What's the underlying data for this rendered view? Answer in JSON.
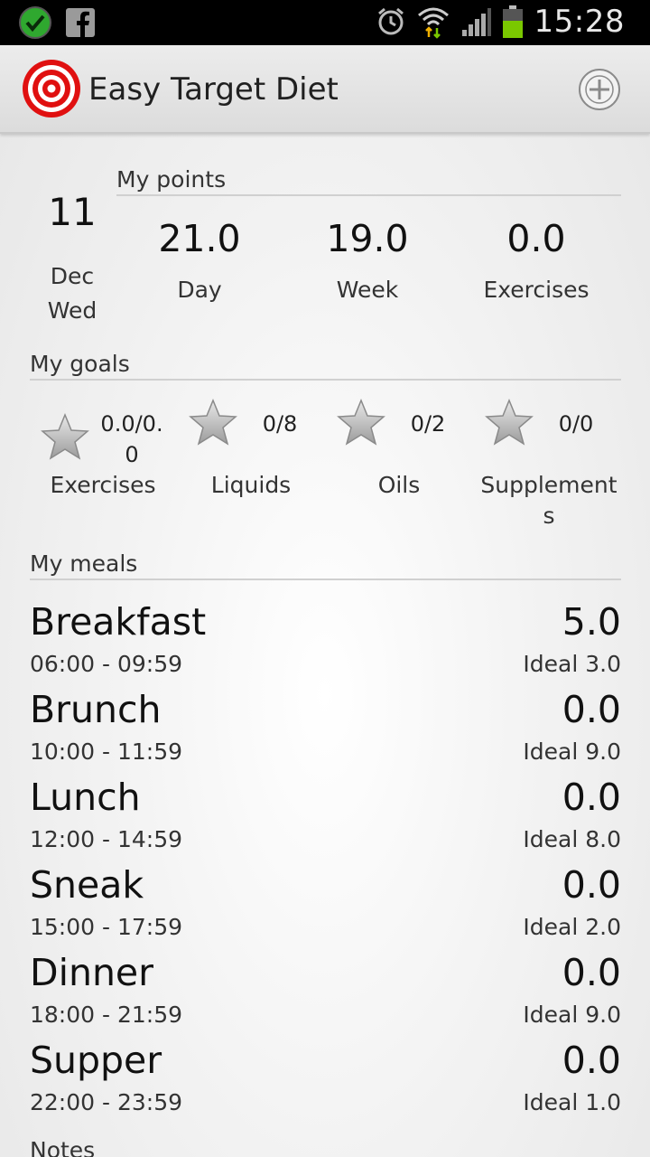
{
  "status_bar": {
    "time": "15:28",
    "icons": [
      "check-circle-icon",
      "facebook-icon",
      "alarm-icon",
      "wifi-icon",
      "signal-icon",
      "battery-icon"
    ]
  },
  "app": {
    "title": "Easy Target Diet",
    "logo_icon": "target-icon",
    "add_icon": "add-circle-icon"
  },
  "date": {
    "day": "11",
    "month": "Dec",
    "weekday": "Wed"
  },
  "points": {
    "section_title": "My points",
    "items": [
      {
        "value": "21.0",
        "label": "Day"
      },
      {
        "value": "19.0",
        "label": "Week"
      },
      {
        "value": "0.0",
        "label": "Exercises"
      }
    ]
  },
  "goals": {
    "section_title": "My goals",
    "items": [
      {
        "value_line1": "0.0/0.",
        "value_line2": "0",
        "label_line1": "Exercises",
        "label_line2": ""
      },
      {
        "value_line1": "0/8",
        "value_line2": "",
        "label_line1": "Liquids",
        "label_line2": ""
      },
      {
        "value_line1": "0/2",
        "value_line2": "",
        "label_line1": "Oils",
        "label_line2": ""
      },
      {
        "value_line1": "0/0",
        "value_line2": "",
        "label_line1": "Supplement",
        "label_line2": "s"
      }
    ]
  },
  "meals": {
    "section_title": "My meals",
    "items": [
      {
        "name": "Breakfast",
        "time": "06:00 - 09:59",
        "points": "5.0",
        "ideal": "Ideal 3.0"
      },
      {
        "name": "Brunch",
        "time": "10:00 - 11:59",
        "points": "0.0",
        "ideal": "Ideal 9.0"
      },
      {
        "name": "Lunch",
        "time": "12:00 - 14:59",
        "points": "0.0",
        "ideal": "Ideal 8.0"
      },
      {
        "name": "Sneak",
        "time": "15:00 - 17:59",
        "points": "0.0",
        "ideal": "Ideal 2.0"
      },
      {
        "name": "Dinner",
        "time": "18:00 - 21:59",
        "points": "0.0",
        "ideal": "Ideal 9.0"
      },
      {
        "name": "Supper",
        "time": "22:00 - 23:59",
        "points": "0.0",
        "ideal": "Ideal 1.0"
      }
    ]
  },
  "notes": {
    "section_title": "Notes"
  },
  "colors": {
    "target_red": "#e01010",
    "battery_green": "#7ac800",
    "check_green": "#2fa82f"
  }
}
